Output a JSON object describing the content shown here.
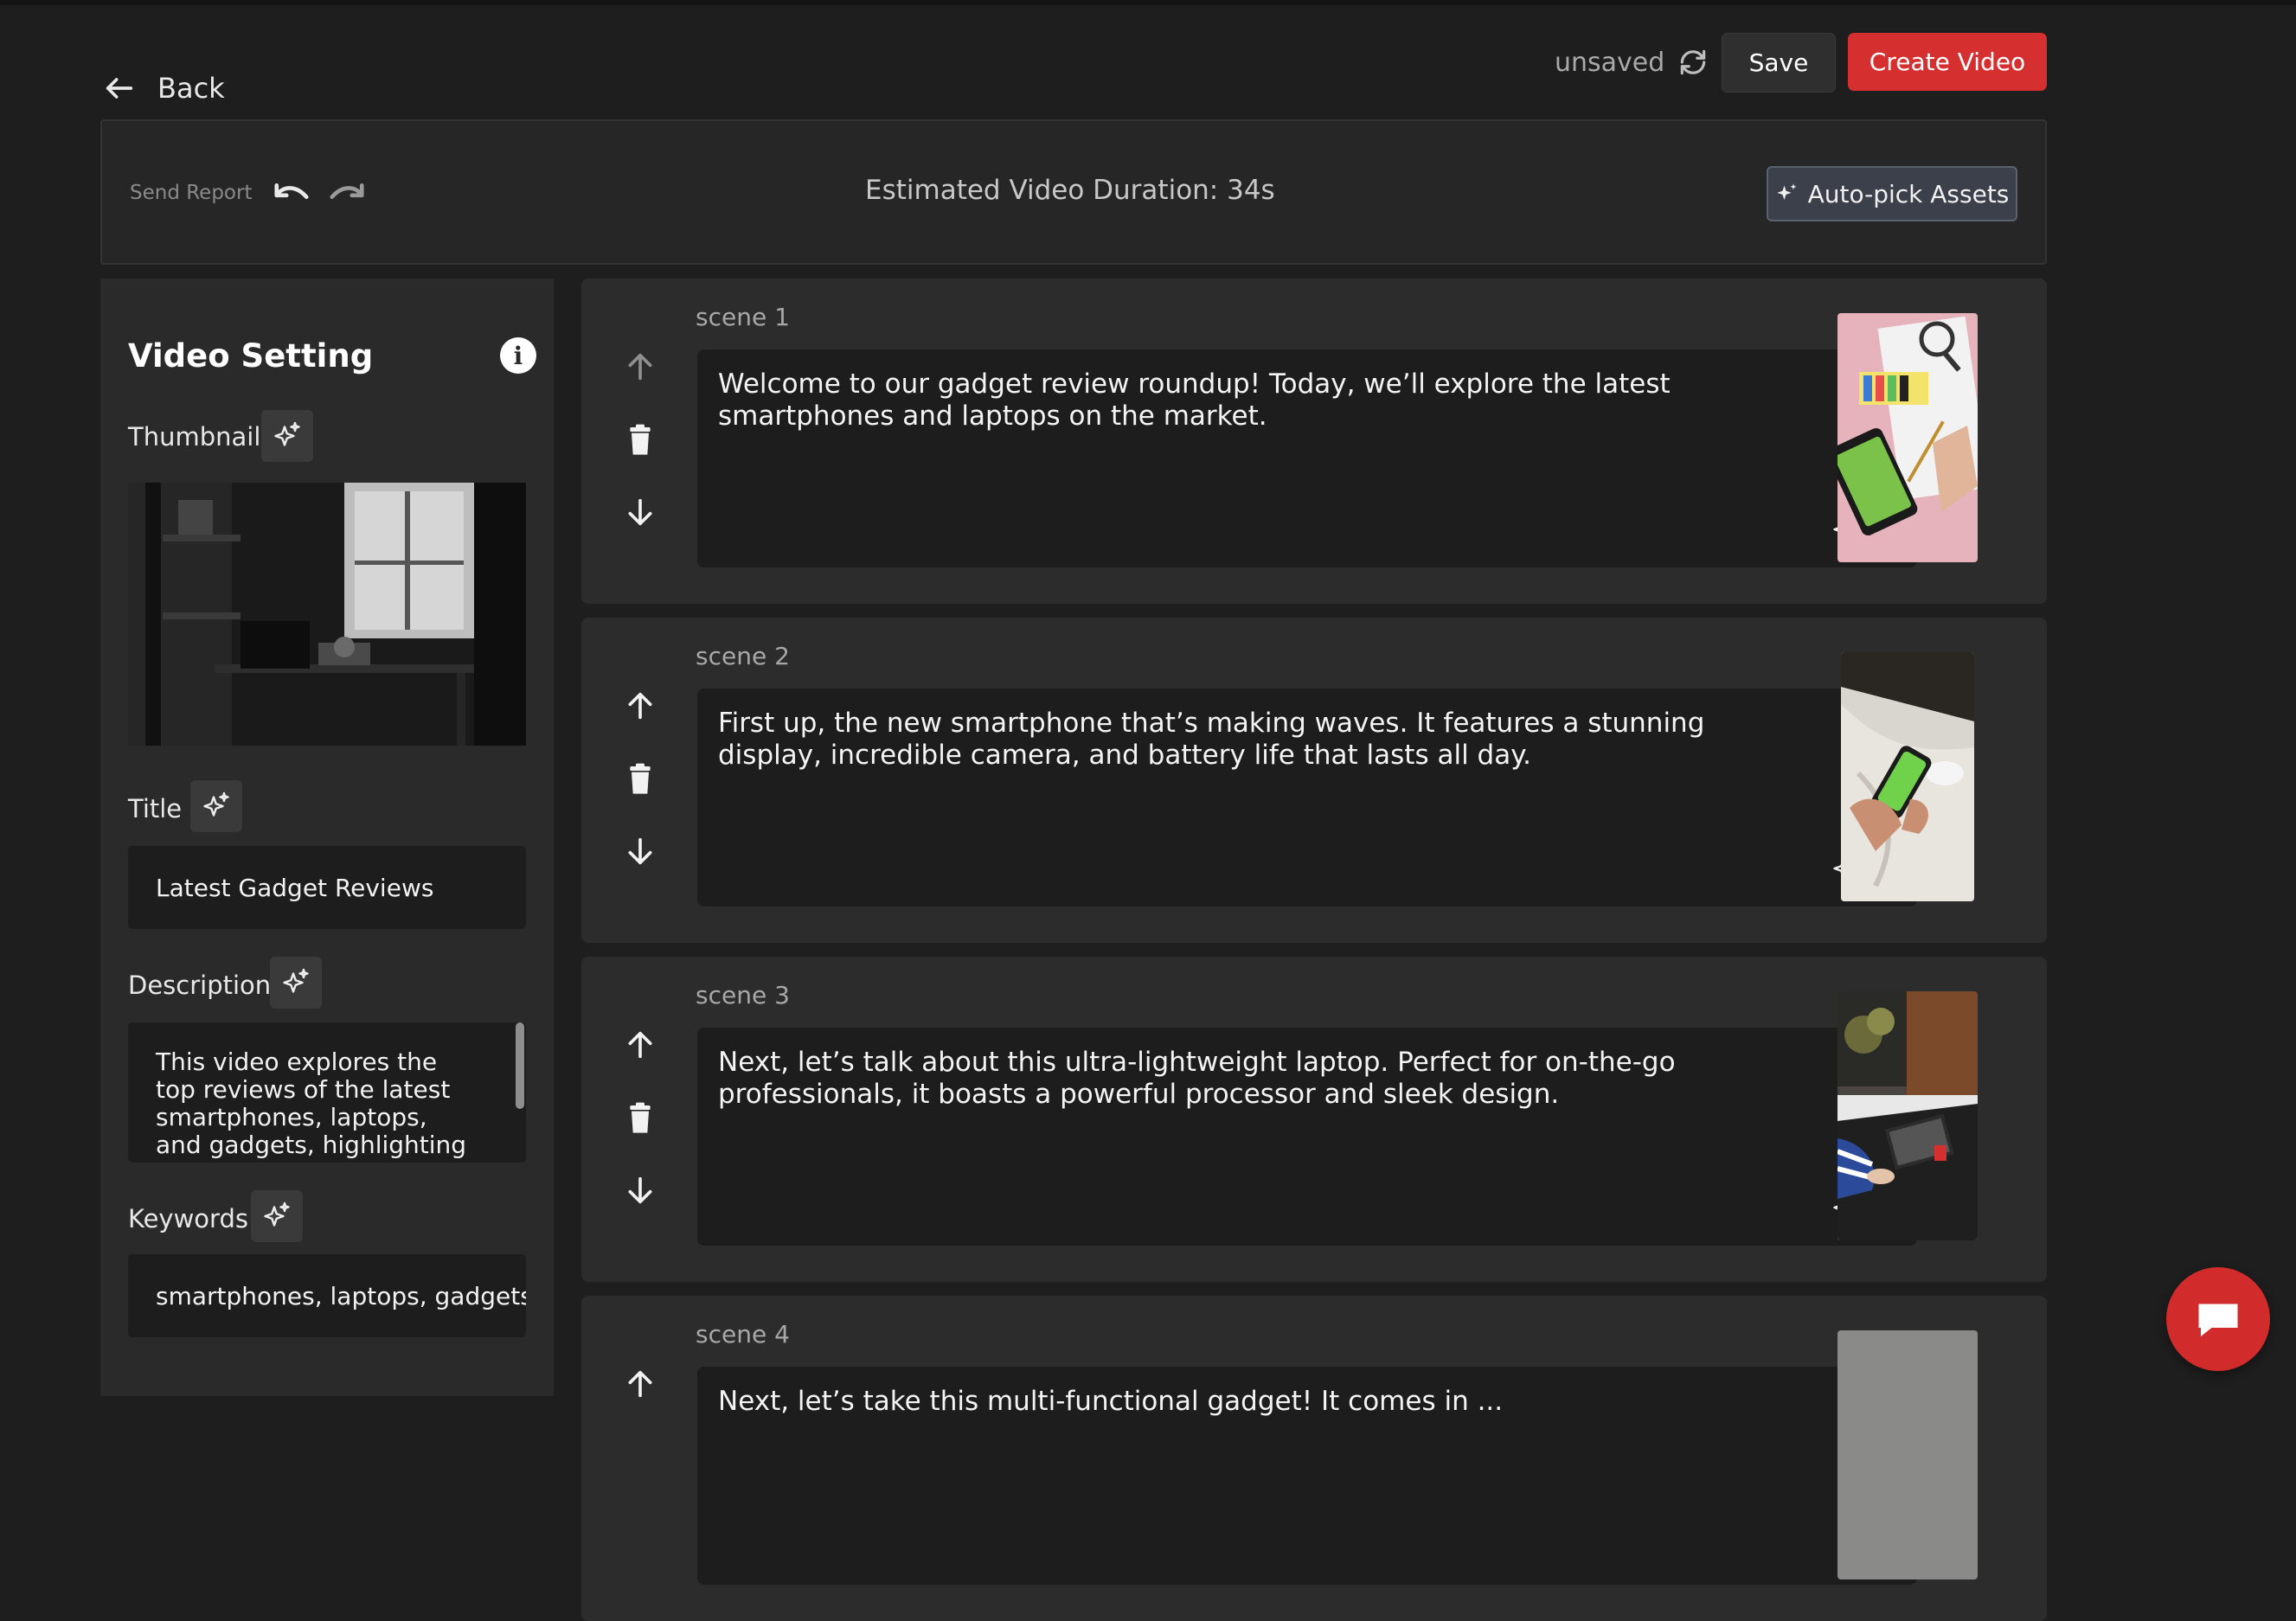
{
  "header": {
    "back_label": "Back",
    "status": "unsaved",
    "save_label": "Save",
    "create_label": "Create Video"
  },
  "toolbar": {
    "send_report": "Send Report",
    "duration": "Estimated Video Duration: 34s",
    "autopick_label": "Auto-pick Assets"
  },
  "sidebar": {
    "title": "Video Setting",
    "thumbnail_label": "Thumbnail",
    "title_label": "Title",
    "title_value": "Latest Gadget Reviews",
    "description_label": "Description",
    "description_value": "This video explores the top reviews of the latest smartphones, laptops, and gadgets, highlighting their",
    "keywords_label": "Keywords",
    "keywords_value": "smartphones, laptops, gadgets"
  },
  "scenes": [
    {
      "label": "scene 1",
      "text": "Welcome to our gadget review roundup! Today, we’ll explore the latest smartphones and laptops on the market."
    },
    {
      "label": "scene 2",
      "text": "First up, the new smartphone that’s making waves. It features a stunning display, incredible camera, and battery life that lasts all day."
    },
    {
      "label": "scene 3",
      "text": "Next, let’s talk about this ultra-lightweight laptop. Perfect for on-the-go professionals, it boasts a powerful processor and sleek design."
    },
    {
      "label": "scene 4",
      "text": "Next, let’s take this multi-functional gadget! It comes in ..."
    }
  ],
  "colors": {
    "background": "#1e1e1e",
    "panel": "#2c2c2c",
    "accent_red": "#d62f2f",
    "autopick_bg": "#3b404a"
  },
  "icons": [
    "back-arrow-icon",
    "sync-icon",
    "undo-icon",
    "redo-icon",
    "sparkle-icon",
    "info-icon",
    "arrow-up-icon",
    "trash-icon",
    "arrow-down-icon",
    "chat-icon"
  ]
}
